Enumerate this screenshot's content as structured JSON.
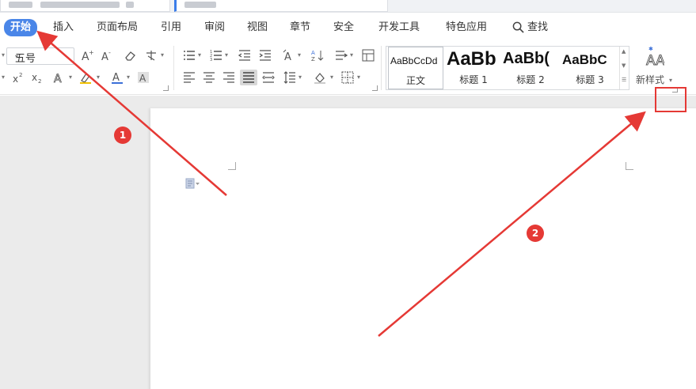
{
  "menu": {
    "items": [
      {
        "label": "开始",
        "active": true
      },
      {
        "label": "插入"
      },
      {
        "label": "页面布局"
      },
      {
        "label": "引用"
      },
      {
        "label": "审阅"
      },
      {
        "label": "视图"
      },
      {
        "label": "章节"
      },
      {
        "label": "安全"
      },
      {
        "label": "开发工具"
      },
      {
        "label": "特色应用"
      }
    ],
    "search_label": "查找"
  },
  "ribbon": {
    "font_size": "五号",
    "styles": [
      {
        "preview": "AaBbCcDd",
        "caption": "正文"
      },
      {
        "preview": "AaBb",
        "caption": "标题 1"
      },
      {
        "preview": "AaBb(",
        "caption": "标题 2"
      },
      {
        "preview": "AaBbC",
        "caption": "标题 3"
      }
    ],
    "new_style_label": "新样式"
  },
  "annotations": {
    "badge1": "1",
    "badge2": "2",
    "color": "#e53935"
  },
  "colors": {
    "accent": "#4a86e8",
    "annotation": "#e53935"
  }
}
